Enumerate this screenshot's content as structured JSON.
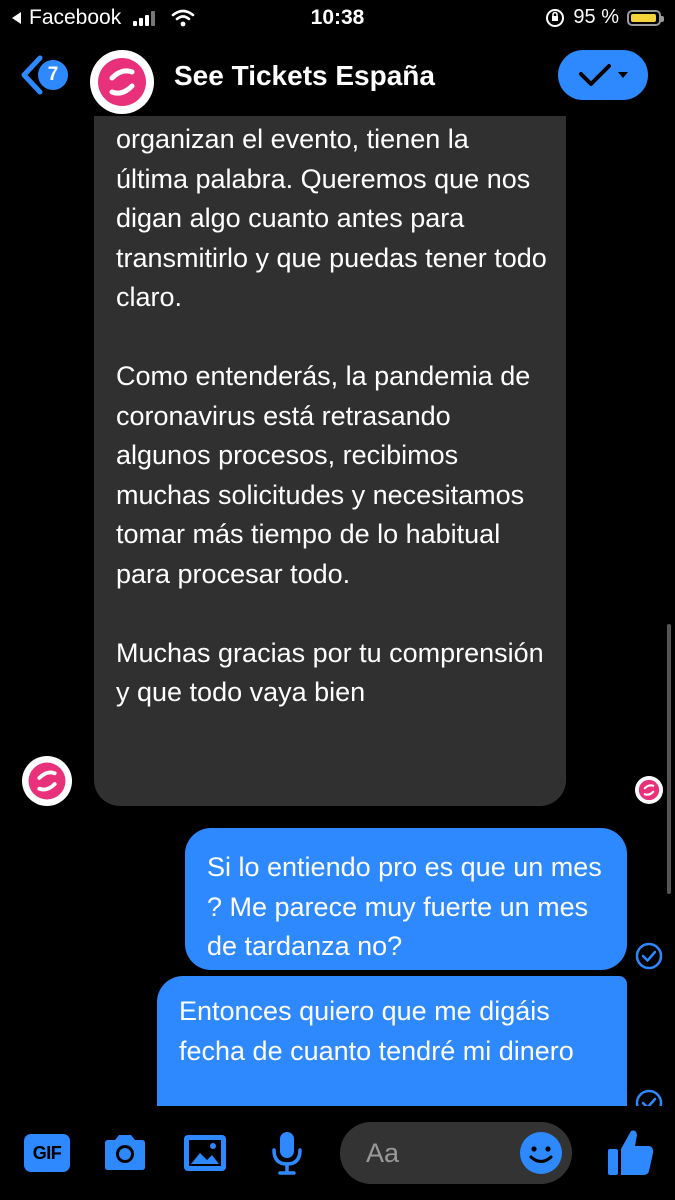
{
  "status_bar": {
    "back_app": "Facebook",
    "time": "10:38",
    "battery": "95 %",
    "battery_level": 0.95,
    "battery_color": "#f5d33b"
  },
  "header": {
    "back_count": "7",
    "title": "See Tickets España",
    "accent_color": "#2e89ff"
  },
  "messages": {
    "incoming": {
      "paragraphs": [
        "organizan el evento, tienen la última palabra. Queremos que nos digan algo cuanto antes para transmitirlo y que puedas tener todo claro.",
        "Como entenderás, la pandemia de coronavirus está retrasando algunos procesos, recibimos muchas solicitudes y necesitamos tomar más tiempo de lo habitual para procesar todo.",
        "Muchas gracias por tu comprensión y que todo vaya bien"
      ]
    },
    "outgoing": [
      {
        "text": "Si lo entiendo pro es que un mes ? Me parece muy fuerte un mes de tardanza no?"
      },
      {
        "text": "Entonces quiero que me digáis fecha de cuanto tendré mi dinero"
      }
    ]
  },
  "composer": {
    "gif_label": "GIF",
    "placeholder": "Aa",
    "icons": [
      "gif-icon",
      "camera-icon",
      "image-icon",
      "microphone-icon",
      "emoji-icon",
      "thumbs-up-icon"
    ]
  }
}
